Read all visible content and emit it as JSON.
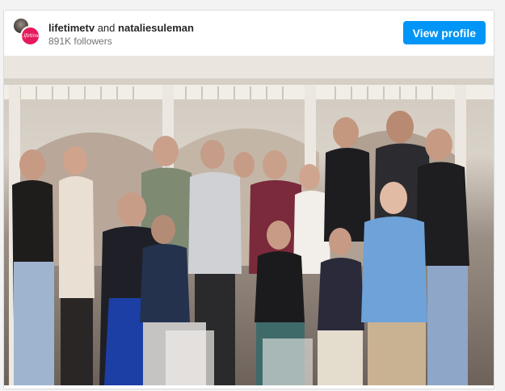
{
  "post": {
    "account_primary": "lifetimetv",
    "joiner": "and",
    "account_secondary": "nataliesuleman",
    "followers": "891K followers",
    "view_profile_label": "View profile",
    "brand_logo_text": "Lifetime"
  },
  "colors": {
    "button_blue": "#0095f6",
    "lifetime_red": "#e5195b",
    "text_primary": "#262626",
    "text_secondary": "#737373"
  },
  "icons": {
    "avatar_back": "profile-photo-icon",
    "avatar_front": "lifetime-logo-icon"
  }
}
